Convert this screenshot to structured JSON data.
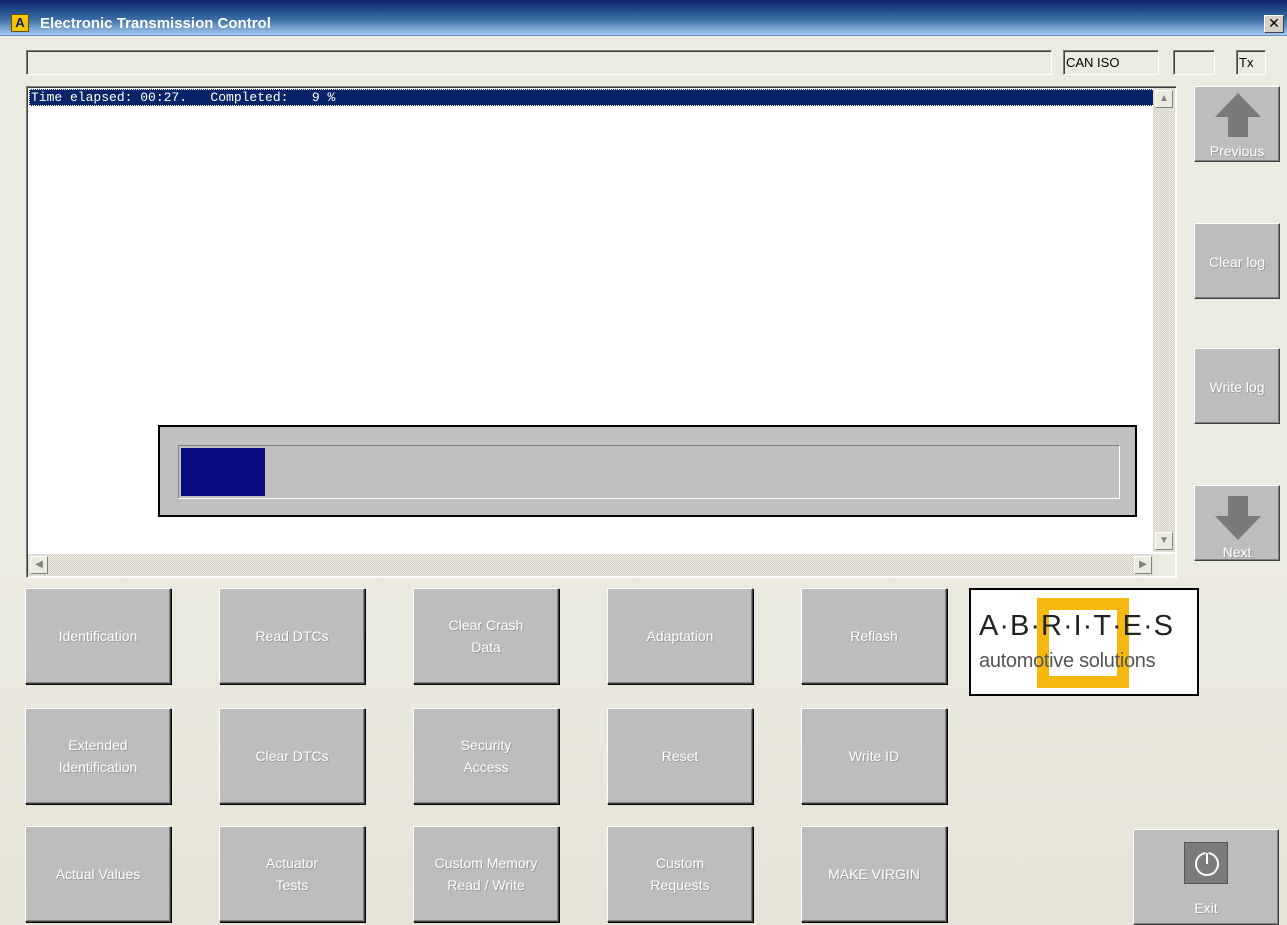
{
  "window": {
    "title": "Electronic Transmission Control",
    "app_icon": "A",
    "close_glyph": "✕"
  },
  "status": {
    "main": "",
    "protocol": "CAN ISO",
    "cell2": "",
    "tx": "Tx"
  },
  "log": {
    "lines": [
      "Time elapsed: 00:27.   Completed:   9 %"
    ]
  },
  "progress": {
    "percent": 9
  },
  "side": {
    "previous": "Previous",
    "clear_log": "Clear log",
    "write_log": "Write log",
    "next": "Next"
  },
  "buttons": {
    "identification": "Identification",
    "read_dtcs": "Read DTCs",
    "clear_crash_data": "Clear Crash\nData",
    "adaptation": "Adaptation",
    "reflash": "Reflash",
    "extended_identification": "Extended\nIdentification",
    "clear_dtcs": "Clear DTCs",
    "security_access": "Security\nAccess",
    "reset": "Reset",
    "write_id": "Write ID",
    "actual_values": "Actual Values",
    "actuator_tests": "Actuator\nTests",
    "custom_memory": "Custom Memory\nRead / Write",
    "custom_requests": "Custom\nRequests",
    "make_virgin": "MAKE VIRGIN",
    "exit": "Exit"
  },
  "logo": {
    "main": "A·B·R·I·T·E·S",
    "sub": "automotive solutions"
  },
  "icons": {
    "up": "arrow-up-icon",
    "down": "arrow-down-icon",
    "power": "power-icon"
  }
}
